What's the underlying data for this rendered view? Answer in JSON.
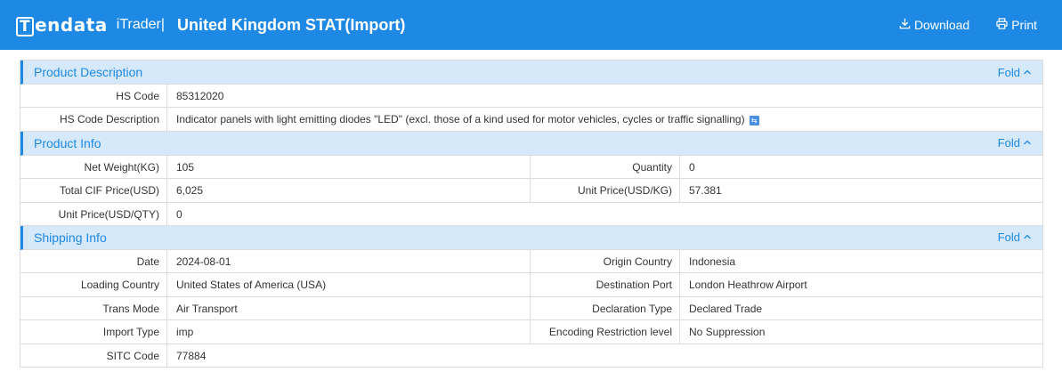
{
  "header": {
    "brand": "endata",
    "brand_initial": "T",
    "product": "iTrader|",
    "title": "United Kingdom STAT(Import)",
    "download_label": "Download",
    "print_label": "Print"
  },
  "fold_label": "Fold",
  "sections": {
    "product_description": {
      "title": "Product Description",
      "hs_code_label": "HS Code",
      "hs_code": "85312020",
      "hs_desc_label": "HS Code Description",
      "hs_desc": "Indicator panels with light emitting diodes \"LED\" (excl. those of a kind used for motor vehicles, cycles or traffic signalling)"
    },
    "product_info": {
      "title": "Product Info",
      "net_weight_label": "Net Weight(KG)",
      "net_weight": "105",
      "quantity_label": "Quantity",
      "quantity": "0",
      "total_cif_label": "Total CIF Price(USD)",
      "total_cif": "6,025",
      "unit_price_kg_label": "Unit Price(USD/KG)",
      "unit_price_kg": "57.381",
      "unit_price_qty_label": "Unit Price(USD/QTY)",
      "unit_price_qty": "0"
    },
    "shipping_info": {
      "title": "Shipping Info",
      "date_label": "Date",
      "date": "2024-08-01",
      "origin_label": "Origin Country",
      "origin": "Indonesia",
      "loading_label": "Loading Country",
      "loading": "United States of America (USA)",
      "dest_port_label": "Destination Port",
      "dest_port": "London Heathrow Airport",
      "trans_mode_label": "Trans Mode",
      "trans_mode": "Air Transport",
      "decl_type_label": "Declaration Type",
      "decl_type": "Declared Trade",
      "import_type_label": "Import Type",
      "import_type": "imp",
      "encoding_label": "Encoding Restriction level",
      "encoding": "No Suppression",
      "sitc_label": "SITC Code",
      "sitc": "77884"
    }
  },
  "icons": {
    "download": "download-icon",
    "print": "print-icon",
    "fold": "chevron-up-icon",
    "translate": "translate-icon"
  },
  "colors": {
    "topbar": "#1e88e5",
    "section_header_bg": "#d6e9fb",
    "accent": "#1e88e5"
  }
}
